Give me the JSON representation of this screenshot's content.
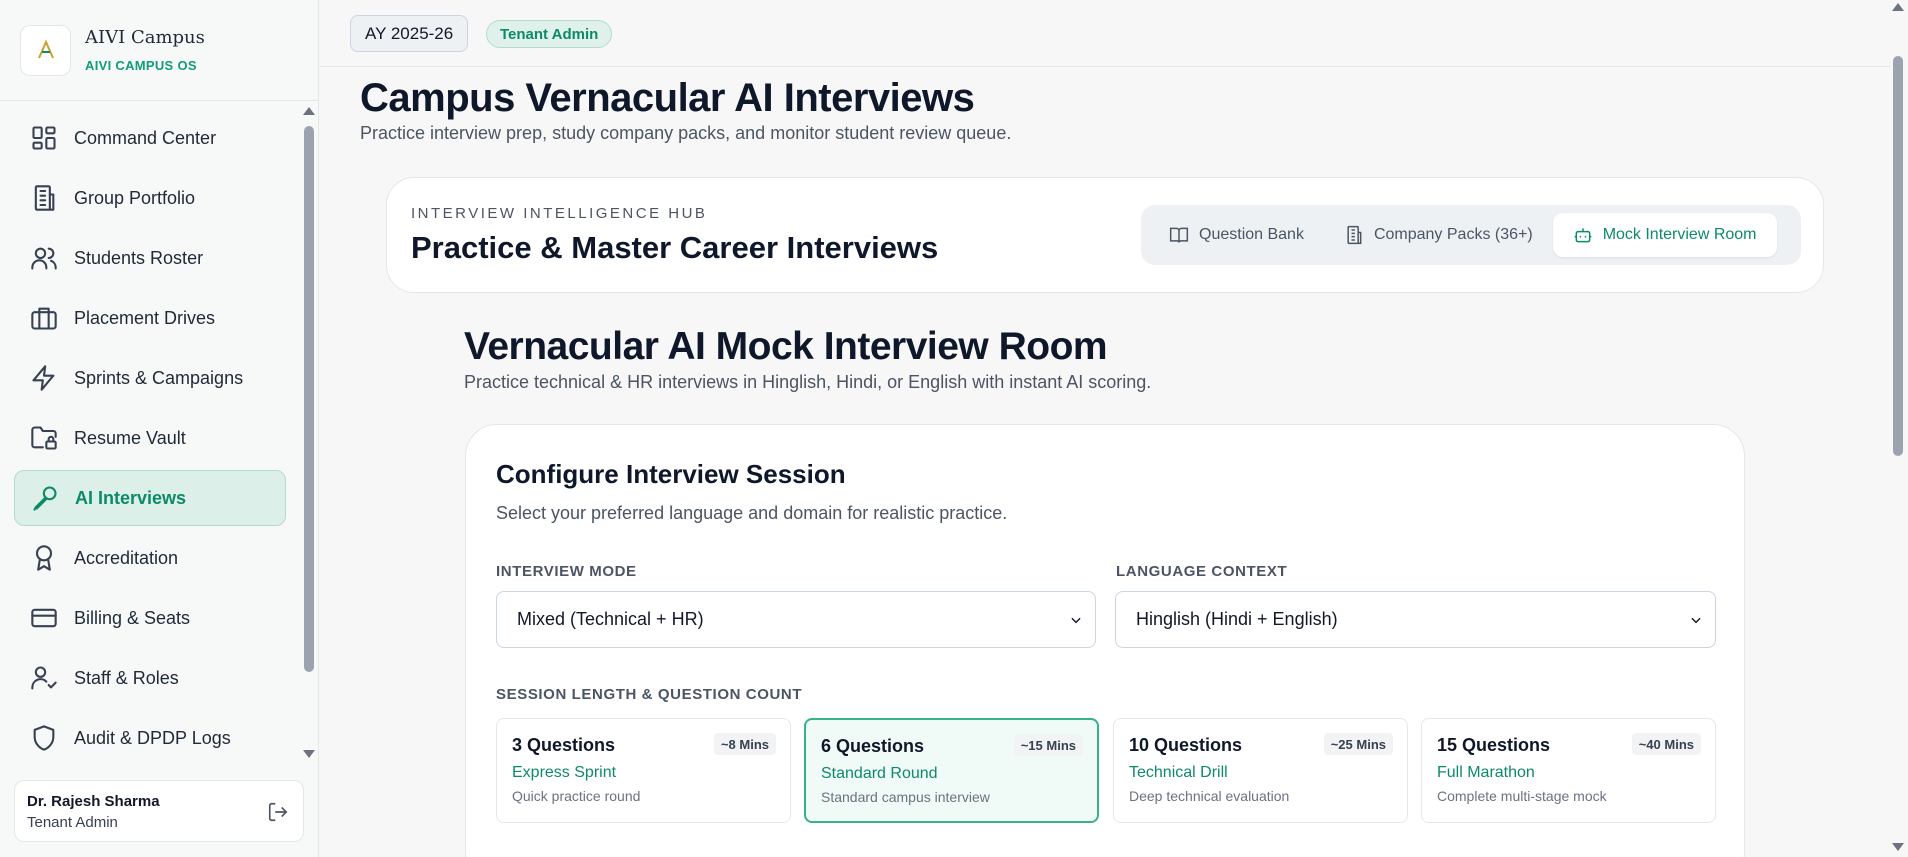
{
  "brand": {
    "name": "AIVI Campus",
    "subtitle": "AIVI CAMPUS OS",
    "logo_letter": "A"
  },
  "sidebar": {
    "items": [
      {
        "label": "Command Center",
        "icon": "dashboard-icon",
        "active": false
      },
      {
        "label": "Group Portfolio",
        "icon": "building-icon",
        "active": false
      },
      {
        "label": "Students Roster",
        "icon": "users-icon",
        "active": false
      },
      {
        "label": "Placement Drives",
        "icon": "briefcase-icon",
        "active": false
      },
      {
        "label": "Sprints & Campaigns",
        "icon": "bolt-icon",
        "active": false
      },
      {
        "label": "Resume Vault",
        "icon": "folder-lock-icon",
        "active": false
      },
      {
        "label": "AI Interviews",
        "icon": "mic-icon",
        "active": true
      },
      {
        "label": "Accreditation",
        "icon": "award-icon",
        "active": false
      },
      {
        "label": "Billing & Seats",
        "icon": "credit-card-icon",
        "active": false
      },
      {
        "label": "Staff & Roles",
        "icon": "user-check-icon",
        "active": false
      },
      {
        "label": "Audit & DPDP Logs",
        "icon": "shield-icon",
        "active": false
      }
    ],
    "user": {
      "name": "Dr. Rajesh Sharma",
      "role": "Tenant Admin"
    }
  },
  "topbar": {
    "academic_year": "AY 2025-26",
    "role_badge": "Tenant Admin"
  },
  "page": {
    "title": "Campus Vernacular AI Interviews",
    "subtitle": "Practice interview prep, study company packs, and monitor student review queue."
  },
  "hub": {
    "eyebrow": "INTERVIEW INTELLIGENCE HUB",
    "title": "Practice & Master Career Interviews",
    "tabs": [
      {
        "label": "Question Bank",
        "icon": "book-icon",
        "active": false
      },
      {
        "label": "Company Packs (36+)",
        "icon": "building-icon",
        "active": false
      },
      {
        "label": "Mock Interview Room",
        "icon": "robot-icon",
        "active": true
      }
    ]
  },
  "room": {
    "title": "Vernacular AI Mock Interview Room",
    "subtitle": "Practice technical & HR interviews in Hinglish, Hindi, or English with instant AI scoring."
  },
  "config": {
    "title": "Configure Interview Session",
    "subtitle": "Select your preferred language and domain for realistic practice.",
    "mode_label": "INTERVIEW MODE",
    "mode_value": "Mixed (Technical + HR)",
    "language_label": "LANGUAGE CONTEXT",
    "language_value": "Hinglish (Hindi + English)",
    "session_label": "SESSION LENGTH & QUESTION COUNT",
    "options": [
      {
        "title": "3 Questions",
        "badge": "~8 Mins",
        "name": "Express Sprint",
        "desc": "Quick practice round",
        "selected": false
      },
      {
        "title": "6 Questions",
        "badge": "~15 Mins",
        "name": "Standard Round",
        "desc": "Standard campus interview",
        "selected": true
      },
      {
        "title": "10 Questions",
        "badge": "~25 Mins",
        "name": "Technical Drill",
        "desc": "Deep technical evaluation",
        "selected": false
      },
      {
        "title": "15 Questions",
        "badge": "~40 Mins",
        "name": "Full Marathon",
        "desc": "Complete multi-stage mock",
        "selected": false
      }
    ]
  },
  "colors": {
    "accent": "#0d8a6a",
    "accent_bg": "#ddefe9",
    "text": "#0f172a"
  }
}
